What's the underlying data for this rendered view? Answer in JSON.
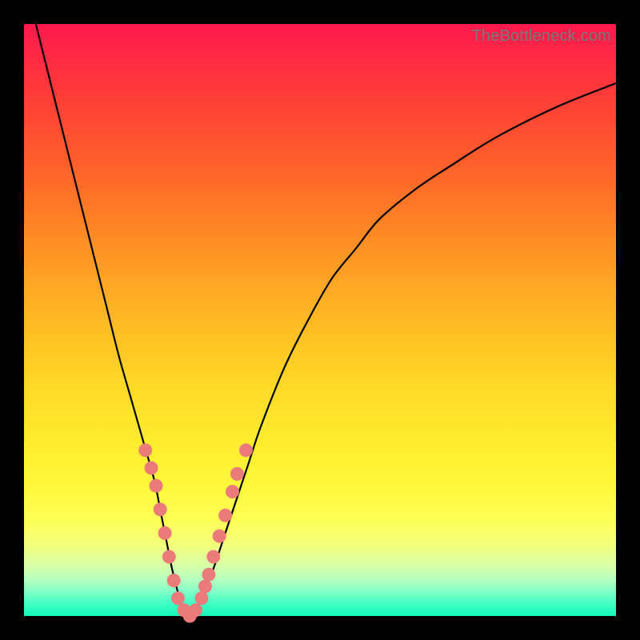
{
  "watermark": "TheBottleneck.com",
  "chart_data": {
    "type": "line",
    "title": "",
    "xlabel": "",
    "ylabel": "",
    "xlim": [
      0,
      100
    ],
    "ylim": [
      0,
      100
    ],
    "grid": false,
    "series": [
      {
        "name": "bottleneck-curve",
        "x": [
          2,
          4,
          6,
          8,
          10,
          12,
          14,
          16,
          18,
          20,
          22,
          23,
          24,
          25,
          26,
          27,
          28,
          29,
          30,
          32,
          34,
          36,
          38,
          40,
          44,
          48,
          52,
          56,
          60,
          66,
          72,
          80,
          90,
          100
        ],
        "y": [
          100,
          92,
          84,
          76,
          68,
          60,
          52,
          44,
          37,
          30,
          23,
          18,
          13,
          8,
          4,
          1,
          0,
          1,
          3,
          8,
          14,
          20,
          26,
          32,
          42,
          50,
          57,
          62,
          67,
          72,
          76,
          81,
          86,
          90
        ]
      }
    ],
    "markers": {
      "name": "highlighted-points",
      "color": "#eb7b7b",
      "points": [
        {
          "x": 20.5,
          "y": 28
        },
        {
          "x": 21.5,
          "y": 25
        },
        {
          "x": 22.3,
          "y": 22
        },
        {
          "x": 23.0,
          "y": 18
        },
        {
          "x": 23.8,
          "y": 14
        },
        {
          "x": 24.5,
          "y": 10
        },
        {
          "x": 25.3,
          "y": 6
        },
        {
          "x": 26.0,
          "y": 3
        },
        {
          "x": 27.0,
          "y": 1
        },
        {
          "x": 28.0,
          "y": 0
        },
        {
          "x": 29.0,
          "y": 1
        },
        {
          "x": 30.0,
          "y": 3
        },
        {
          "x": 30.6,
          "y": 5
        },
        {
          "x": 31.2,
          "y": 7
        },
        {
          "x": 32.0,
          "y": 10
        },
        {
          "x": 33.0,
          "y": 13.5
        },
        {
          "x": 34.0,
          "y": 17
        },
        {
          "x": 35.2,
          "y": 21
        },
        {
          "x": 36.0,
          "y": 24
        },
        {
          "x": 37.5,
          "y": 28
        }
      ]
    }
  }
}
